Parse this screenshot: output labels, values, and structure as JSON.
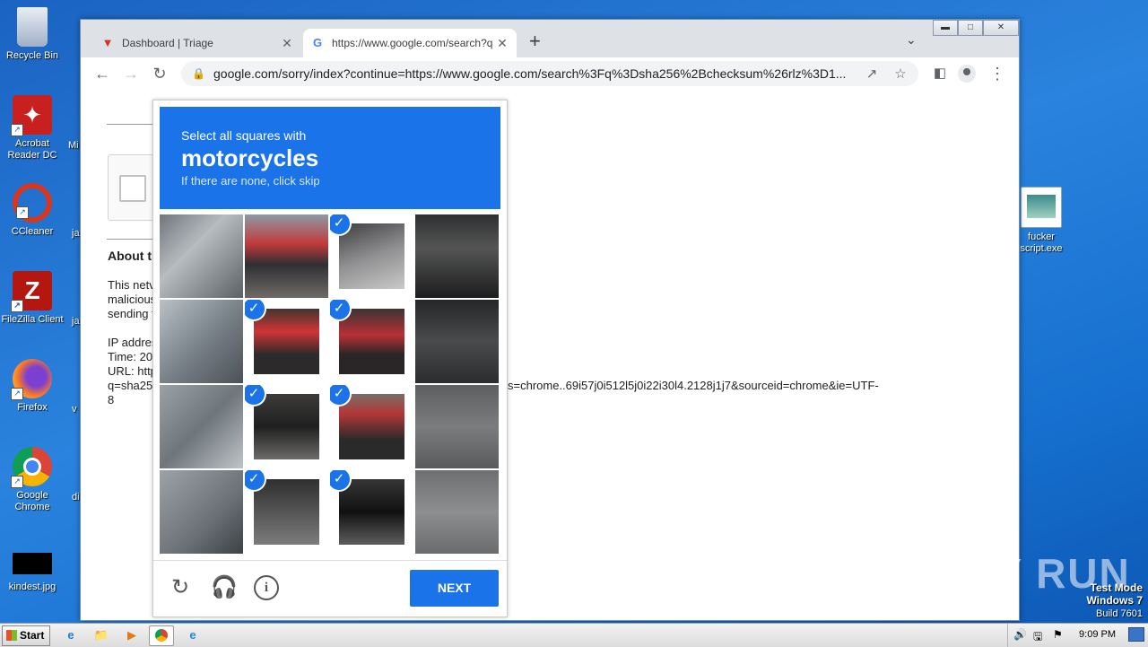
{
  "desktop": {
    "icons": [
      {
        "label": "Recycle Bin",
        "icon": "recycle-bin-icon"
      },
      {
        "label": "Acrobat Reader DC",
        "icon": "acrobat-icon"
      },
      {
        "label": "CCleaner",
        "icon": "ccleaner-icon"
      },
      {
        "label": "FileZilla Client",
        "icon": "filezilla-icon"
      },
      {
        "label": "Firefox",
        "icon": "firefox-icon"
      },
      {
        "label": "Google Chrome",
        "icon": "chrome-icon"
      },
      {
        "label": "kindest.jpg",
        "icon": "image-file-icon"
      },
      {
        "label": "fucker script.exe",
        "icon": "exe-file-icon"
      }
    ],
    "partial_labels": [
      "Mi",
      "ja",
      "ja",
      "v",
      "di"
    ]
  },
  "browser": {
    "tabs": [
      {
        "title": "Dashboard | Triage",
        "favicon": "triage-favicon",
        "active": false
      },
      {
        "title": "https://www.google.com/search?q=",
        "favicon": "google-favicon",
        "active": true
      }
    ],
    "url": "google.com/sorry/index?continue=https://www.google.com/search%3Fq%3Dsha256%2Bchecksum%26rlz%3D1...",
    "window_controls": [
      "minimize",
      "restore",
      "close"
    ]
  },
  "page": {
    "about_heading": "About th",
    "paragraph_lines": [
      "This netv",
      "malicious",
      "sending t"
    ],
    "info_lines": [
      "IP addres",
      "Time: 20",
      "URL: http",
      "q=sha25",
      "8"
    ],
    "url_tail": "s=chrome..69i57j0i512l5j0i22i30l4.2128j1j7&sourceid=chrome&ie=UTF-"
  },
  "captcha": {
    "prompt_line1": "Select all squares with",
    "target": "motorcycles",
    "hint": "If there are none, click skip",
    "next_label": "NEXT",
    "tiles": [
      {
        "selected": false
      },
      {
        "selected": false
      },
      {
        "selected": true
      },
      {
        "selected": false
      },
      {
        "selected": false
      },
      {
        "selected": true
      },
      {
        "selected": true
      },
      {
        "selected": false
      },
      {
        "selected": false
      },
      {
        "selected": true
      },
      {
        "selected": true
      },
      {
        "selected": false
      },
      {
        "selected": false
      },
      {
        "selected": true
      },
      {
        "selected": true
      },
      {
        "selected": false
      }
    ],
    "accent_color": "#1a73e8"
  },
  "taskbar": {
    "start_label": "Start",
    "clock": "9:09 PM",
    "pinned": [
      "ie-icon",
      "explorer-icon",
      "media-player-icon",
      "chrome-icon",
      "edge-icon"
    ]
  },
  "watermark": {
    "mode": "Test Mode",
    "os": "Windows 7",
    "build": "Build 7601",
    "brand": "ANY RUN"
  }
}
